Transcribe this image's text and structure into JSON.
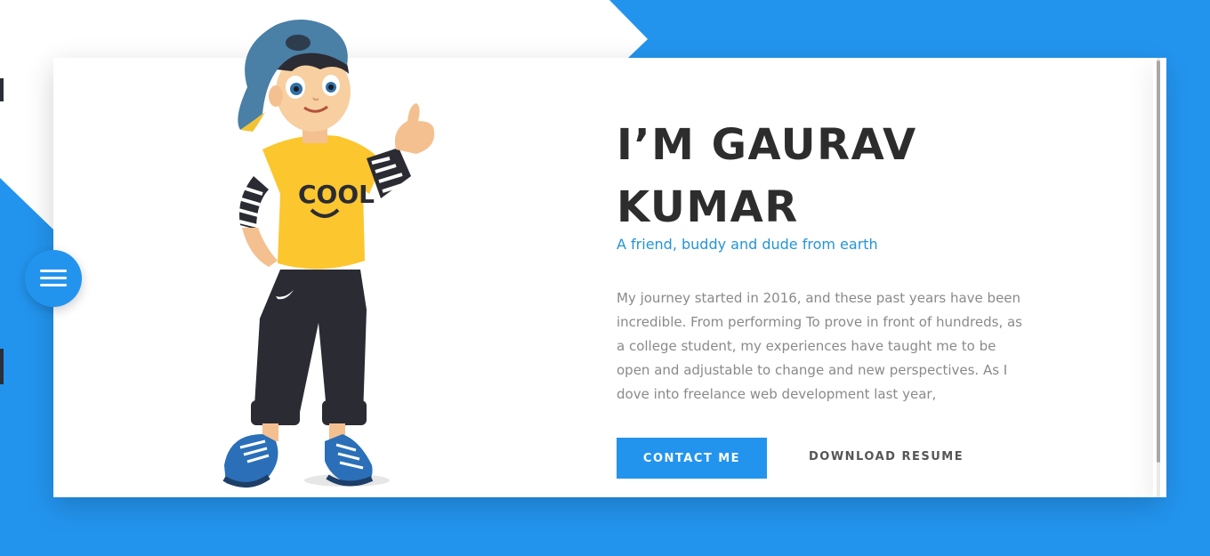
{
  "theme": {
    "accent": "#2394ee",
    "heading_color": "#2d2d2d",
    "subtitle_color": "#2394d8",
    "body_text_color": "#8a8a8a"
  },
  "nav": {
    "menu_icon": "hamburger-menu-icon"
  },
  "hero": {
    "name_line1": "I’M GAURAV",
    "name_line2": "KUMAR",
    "subtitle": "A friend, buddy and dude from earth",
    "bio_lines": [
      "My journey started in 2016, and these past years have been",
      "incredible. From performing To prove in front of hundreds, as",
      "a college student, my experiences have taught me to be",
      "open and adjustable to change and new perspectives. As I",
      "dove into freelance web development last year,"
    ],
    "illustration": "cartoon-boy-thumbs-up",
    "shirt_text": "COOL"
  },
  "actions": {
    "contact_label": "CONTACT ME",
    "resume_label": "DOWNLOAD RESUME"
  }
}
